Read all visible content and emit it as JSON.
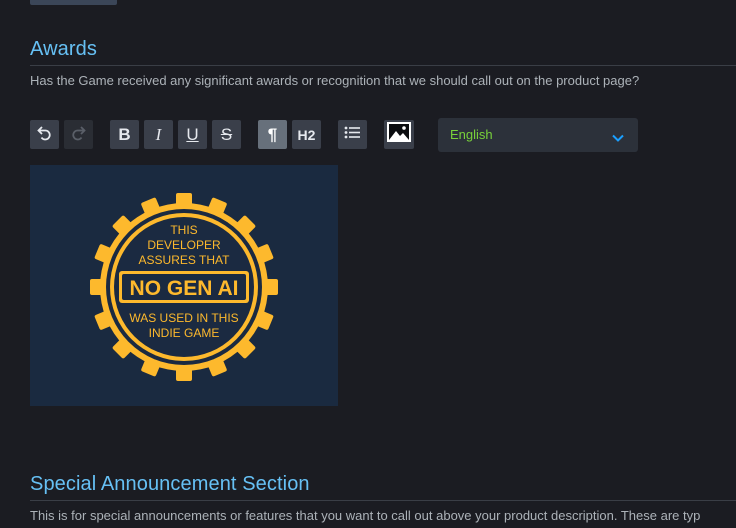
{
  "awards": {
    "title": "Awards",
    "description": "Has the Game received any significant awards or recognition that we should call out on the product page?"
  },
  "toolbar": {
    "buttons": [
      {
        "name": "undo-button",
        "icon": "undo-icon"
      },
      {
        "name": "redo-button",
        "icon": "redo-icon",
        "disabled": true
      },
      {
        "name": "bold-button",
        "label": "B"
      },
      {
        "name": "italic-button",
        "label": "I"
      },
      {
        "name": "underline-button",
        "label": "U"
      },
      {
        "name": "strikethrough-button",
        "label": "S"
      },
      {
        "name": "paragraph-button",
        "label": "¶",
        "active": true
      },
      {
        "name": "heading2-button",
        "label": "H2"
      },
      {
        "name": "bullet-list-button",
        "icon": "list-icon"
      },
      {
        "name": "insert-image-button",
        "icon": "image-icon"
      }
    ],
    "language": {
      "value": "English",
      "color": "#78d13a"
    }
  },
  "badge": {
    "line1": "THIS",
    "line2": "DEVELOPER",
    "line3": "ASSURES THAT",
    "headline": "NO GEN AI",
    "line4": "WAS USED IN THIS",
    "line5": "INDIE GAME",
    "gear_color": "#fdb92d",
    "dark_color": "#1b2a41"
  },
  "announcement": {
    "title": "Special Announcement Section",
    "description": "This is for special announcements or features that you want to call out above your product description. These are typ"
  },
  "colors": {
    "accent": "#66c0f4",
    "background": "#1b1c22"
  }
}
